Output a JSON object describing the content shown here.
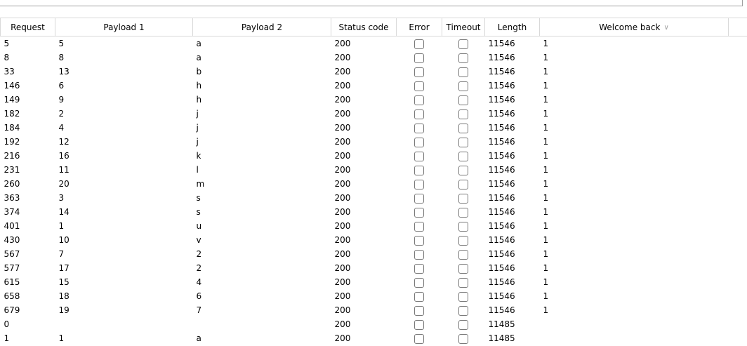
{
  "columns": [
    {
      "key": "request",
      "label": "Request"
    },
    {
      "key": "payload1",
      "label": "Payload 1"
    },
    {
      "key": "payload2",
      "label": "Payload 2"
    },
    {
      "key": "status",
      "label": "Status code"
    },
    {
      "key": "error",
      "label": "Error"
    },
    {
      "key": "timeout",
      "label": "Timeout"
    },
    {
      "key": "length",
      "label": "Length"
    },
    {
      "key": "welcome",
      "label": "Welcome back",
      "sorted": "descending"
    },
    {
      "key": "extra",
      "label": ""
    }
  ],
  "sort_caret": "∨",
  "rows": [
    {
      "request": "5",
      "payload1": "5",
      "payload2": "a",
      "status": "200",
      "error": false,
      "timeout": false,
      "length": "11546",
      "welcome": "1"
    },
    {
      "request": "8",
      "payload1": "8",
      "payload2": "a",
      "status": "200",
      "error": false,
      "timeout": false,
      "length": "11546",
      "welcome": "1"
    },
    {
      "request": "33",
      "payload1": "13",
      "payload2": "b",
      "status": "200",
      "error": false,
      "timeout": false,
      "length": "11546",
      "welcome": "1"
    },
    {
      "request": "146",
      "payload1": "6",
      "payload2": "h",
      "status": "200",
      "error": false,
      "timeout": false,
      "length": "11546",
      "welcome": "1"
    },
    {
      "request": "149",
      "payload1": "9",
      "payload2": "h",
      "status": "200",
      "error": false,
      "timeout": false,
      "length": "11546",
      "welcome": "1"
    },
    {
      "request": "182",
      "payload1": "2",
      "payload2": "j",
      "status": "200",
      "error": false,
      "timeout": false,
      "length": "11546",
      "welcome": "1"
    },
    {
      "request": "184",
      "payload1": "4",
      "payload2": "j",
      "status": "200",
      "error": false,
      "timeout": false,
      "length": "11546",
      "welcome": "1"
    },
    {
      "request": "192",
      "payload1": "12",
      "payload2": "j",
      "status": "200",
      "error": false,
      "timeout": false,
      "length": "11546",
      "welcome": "1"
    },
    {
      "request": "216",
      "payload1": "16",
      "payload2": "k",
      "status": "200",
      "error": false,
      "timeout": false,
      "length": "11546",
      "welcome": "1"
    },
    {
      "request": "231",
      "payload1": "11",
      "payload2": "l",
      "status": "200",
      "error": false,
      "timeout": false,
      "length": "11546",
      "welcome": "1"
    },
    {
      "request": "260",
      "payload1": "20",
      "payload2": "m",
      "status": "200",
      "error": false,
      "timeout": false,
      "length": "11546",
      "welcome": "1"
    },
    {
      "request": "363",
      "payload1": "3",
      "payload2": "s",
      "status": "200",
      "error": false,
      "timeout": false,
      "length": "11546",
      "welcome": "1"
    },
    {
      "request": "374",
      "payload1": "14",
      "payload2": "s",
      "status": "200",
      "error": false,
      "timeout": false,
      "length": "11546",
      "welcome": "1"
    },
    {
      "request": "401",
      "payload1": "1",
      "payload2": "u",
      "status": "200",
      "error": false,
      "timeout": false,
      "length": "11546",
      "welcome": "1"
    },
    {
      "request": "430",
      "payload1": "10",
      "payload2": "v",
      "status": "200",
      "error": false,
      "timeout": false,
      "length": "11546",
      "welcome": "1"
    },
    {
      "request": "567",
      "payload1": "7",
      "payload2": "2",
      "status": "200",
      "error": false,
      "timeout": false,
      "length": "11546",
      "welcome": "1"
    },
    {
      "request": "577",
      "payload1": "17",
      "payload2": "2",
      "status": "200",
      "error": false,
      "timeout": false,
      "length": "11546",
      "welcome": "1"
    },
    {
      "request": "615",
      "payload1": "15",
      "payload2": "4",
      "status": "200",
      "error": false,
      "timeout": false,
      "length": "11546",
      "welcome": "1"
    },
    {
      "request": "658",
      "payload1": "18",
      "payload2": "6",
      "status": "200",
      "error": false,
      "timeout": false,
      "length": "11546",
      "welcome": "1"
    },
    {
      "request": "679",
      "payload1": "19",
      "payload2": "7",
      "status": "200",
      "error": false,
      "timeout": false,
      "length": "11546",
      "welcome": "1"
    },
    {
      "request": "0",
      "payload1": "",
      "payload2": "",
      "status": "200",
      "error": false,
      "timeout": false,
      "length": "11485",
      "welcome": ""
    },
    {
      "request": "1",
      "payload1": "1",
      "payload2": "a",
      "status": "200",
      "error": false,
      "timeout": false,
      "length": "11485",
      "welcome": ""
    }
  ]
}
